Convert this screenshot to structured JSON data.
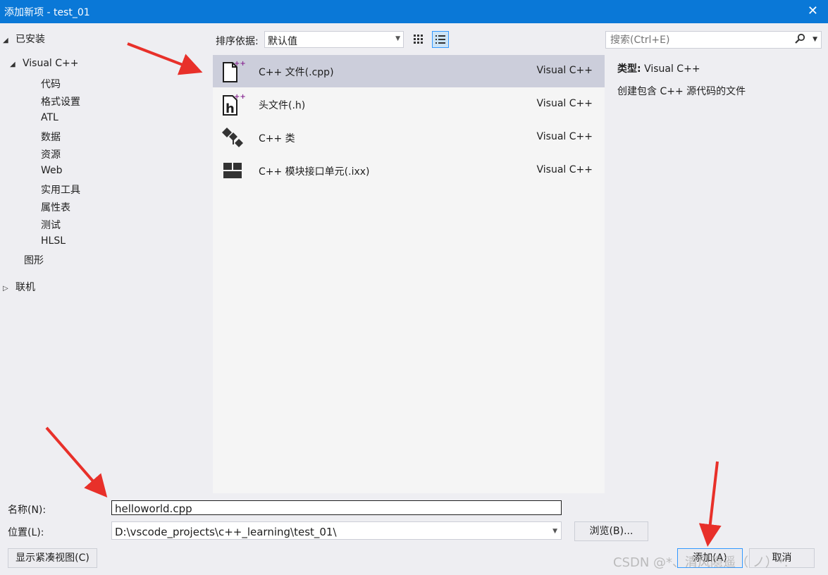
{
  "window": {
    "title": "添加新项 - test_01",
    "close_glyph": "✕"
  },
  "tree": {
    "installed": "已安装",
    "visual_cpp": "Visual C++",
    "children": [
      "代码",
      "格式设置",
      "ATL",
      "数据",
      "资源",
      "Web",
      "实用工具",
      "属性表",
      "测试",
      "HLSL"
    ],
    "graphics": "图形",
    "online": "联机"
  },
  "toolbar": {
    "sort_label": "排序依据:",
    "sort_value": "默认值",
    "search_placeholder": "搜索(Ctrl+E)"
  },
  "items": [
    {
      "name": "C++ 文件(.cpp)",
      "category": "Visual C++",
      "selected": true
    },
    {
      "name": "头文件(.h)",
      "category": "Visual C++",
      "selected": false
    },
    {
      "name": "C++ 类",
      "category": "Visual C++",
      "selected": false
    },
    {
      "name": "C++ 模块接口单元(.ixx)",
      "category": "Visual C++",
      "selected": false
    }
  ],
  "info": {
    "type_label": "类型:",
    "type_value": "Visual C++",
    "description": "创建包含 C++ 源代码的文件"
  },
  "form": {
    "name_label": "名称(N):",
    "name_value": "helloworld.cpp",
    "location_label": "位置(L):",
    "location_value": "D:\\vscode_projects\\c++_learning\\test_01\\",
    "browse_label": "浏览(B)...",
    "compact_view_label": "显示紧凑视图(C)",
    "add_label": "添加(A)",
    "cancel_label": "取消"
  },
  "watermark": "CSDN @*、清风隐遥（ ノ）*.",
  "colors": {
    "accent": "#0a78d7",
    "selection": "#cccedb",
    "arrow": "#e8302a",
    "icon_plus": "#8b2f95"
  }
}
